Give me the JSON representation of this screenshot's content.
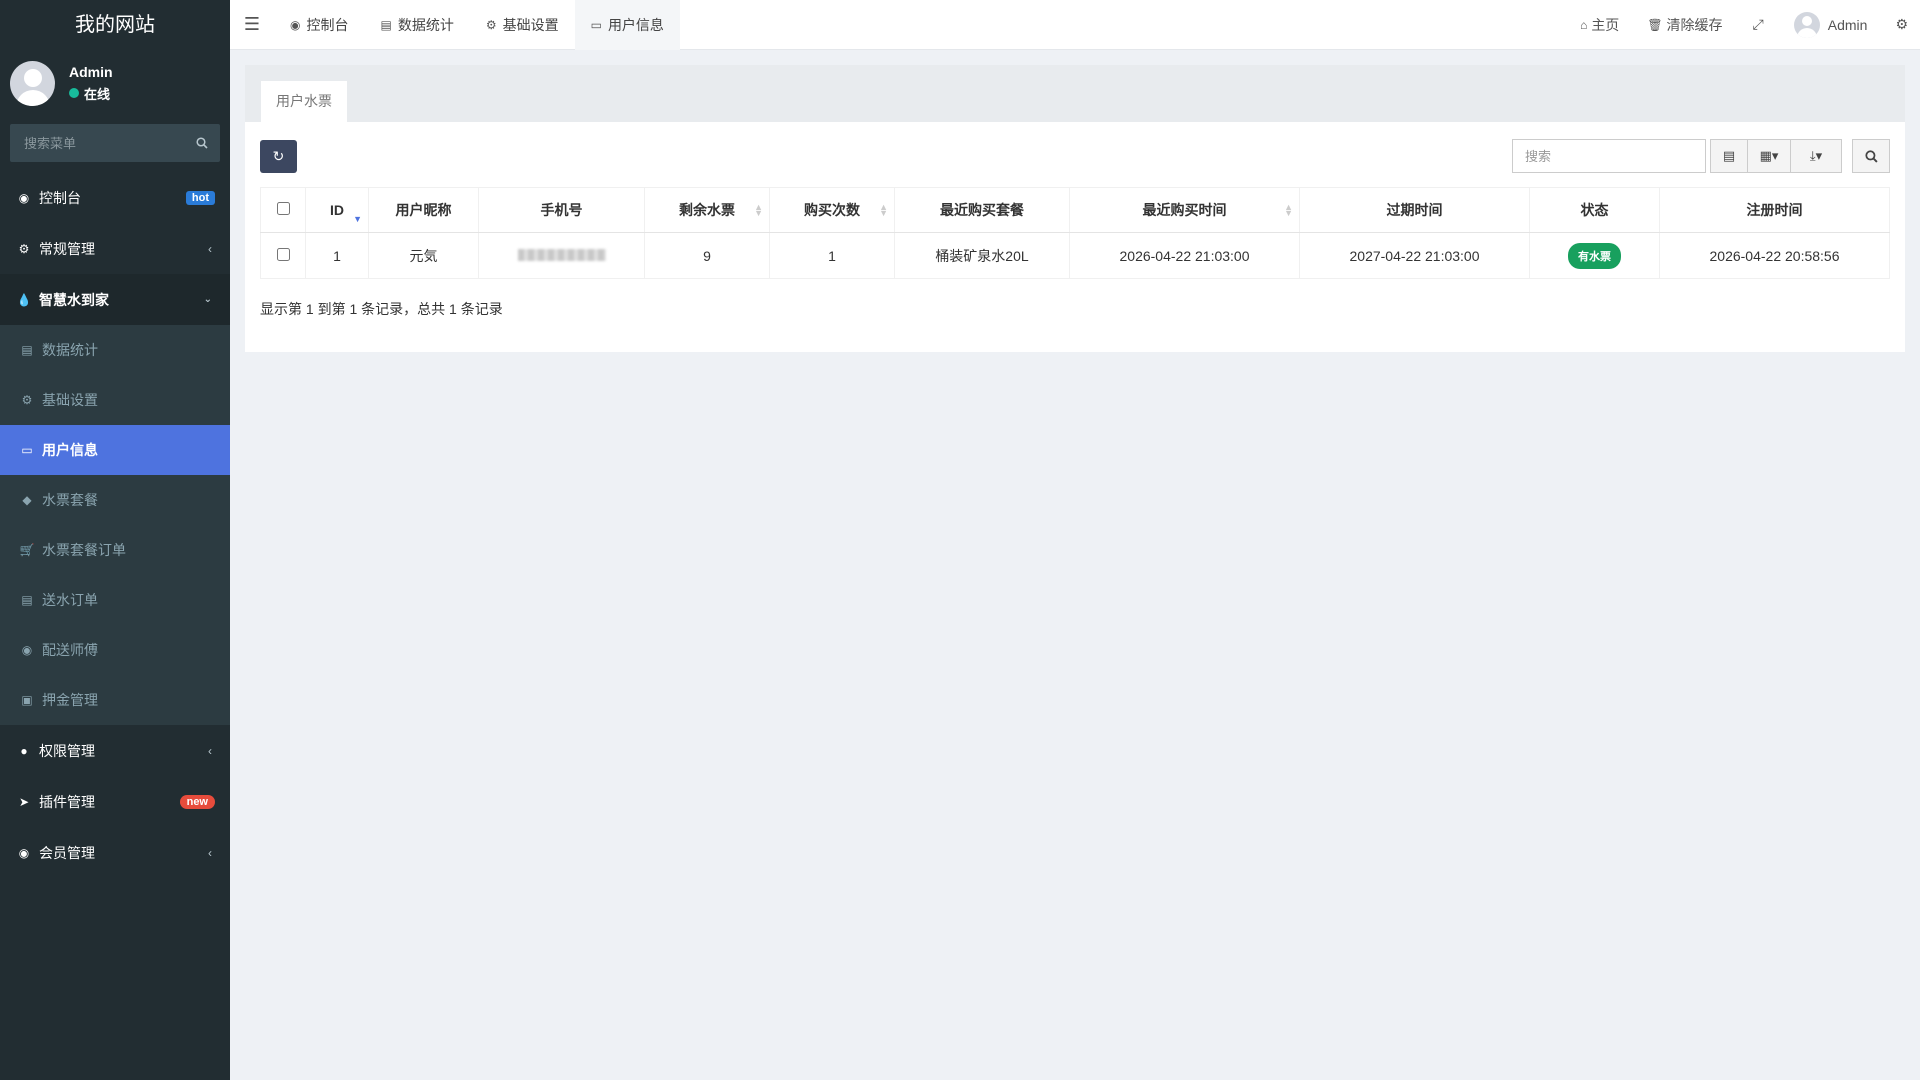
{
  "brand": "我的网站",
  "user": {
    "name": "Admin",
    "status": "在线",
    "status_color": "#18bc9c"
  },
  "sidebar": {
    "search_placeholder": "搜索菜单",
    "items": [
      {
        "label": "控制台",
        "icon": "dashboard-icon",
        "badge": "hot"
      },
      {
        "label": "常规管理",
        "icon": "cogs-icon"
      },
      {
        "label": "智慧水到家",
        "icon": "tint-icon"
      },
      {
        "label": "权限管理",
        "icon": "users-icon"
      },
      {
        "label": "插件管理",
        "icon": "rocket-icon",
        "badge": "new"
      },
      {
        "label": "会员管理",
        "icon": "user-circle-icon"
      }
    ],
    "submenu": [
      {
        "label": "数据统计",
        "icon": "bar-chart-icon"
      },
      {
        "label": "基础设置",
        "icon": "gear-icon"
      },
      {
        "label": "用户信息",
        "icon": "card-icon"
      },
      {
        "label": "水票套餐",
        "icon": "ticket-icon"
      },
      {
        "label": "水票套餐订单",
        "icon": "cart-icon"
      },
      {
        "label": "送水订单",
        "icon": "list-icon"
      },
      {
        "label": "配送师傅",
        "icon": "user-circle-icon"
      },
      {
        "label": "押金管理",
        "icon": "money-icon"
      }
    ]
  },
  "header": {
    "tabs": [
      "控制台",
      "数据统计",
      "基础设置",
      "用户信息"
    ],
    "home": "主页",
    "clear_cache": "清除缓存",
    "admin": "Admin"
  },
  "panel": {
    "tab": "用户水票",
    "search_placeholder": "搜索"
  },
  "table": {
    "columns": [
      "ID",
      "用户昵称",
      "手机号",
      "剩余水票",
      "购买次数",
      "最近购买套餐",
      "最近购买时间",
      "过期时间",
      "状态",
      "注册时间"
    ],
    "rows": [
      {
        "id": "1",
        "nickname": "元気",
        "phone": "",
        "remaining": "9",
        "purchases": "1",
        "package": "桶装矿泉水20L",
        "last_purchase": "2026-04-22 21:03:00",
        "expire": "2027-04-22 21:03:00",
        "status": "有水票",
        "registered": "2026-04-22 20:58:56"
      }
    ]
  },
  "pagination_info": "显示第 1 到第 1 条记录，总共 1 条记录",
  "colors": {
    "active": "#4e73df",
    "sidebar_bg": "#222d32",
    "status_green": "#18a05e"
  }
}
